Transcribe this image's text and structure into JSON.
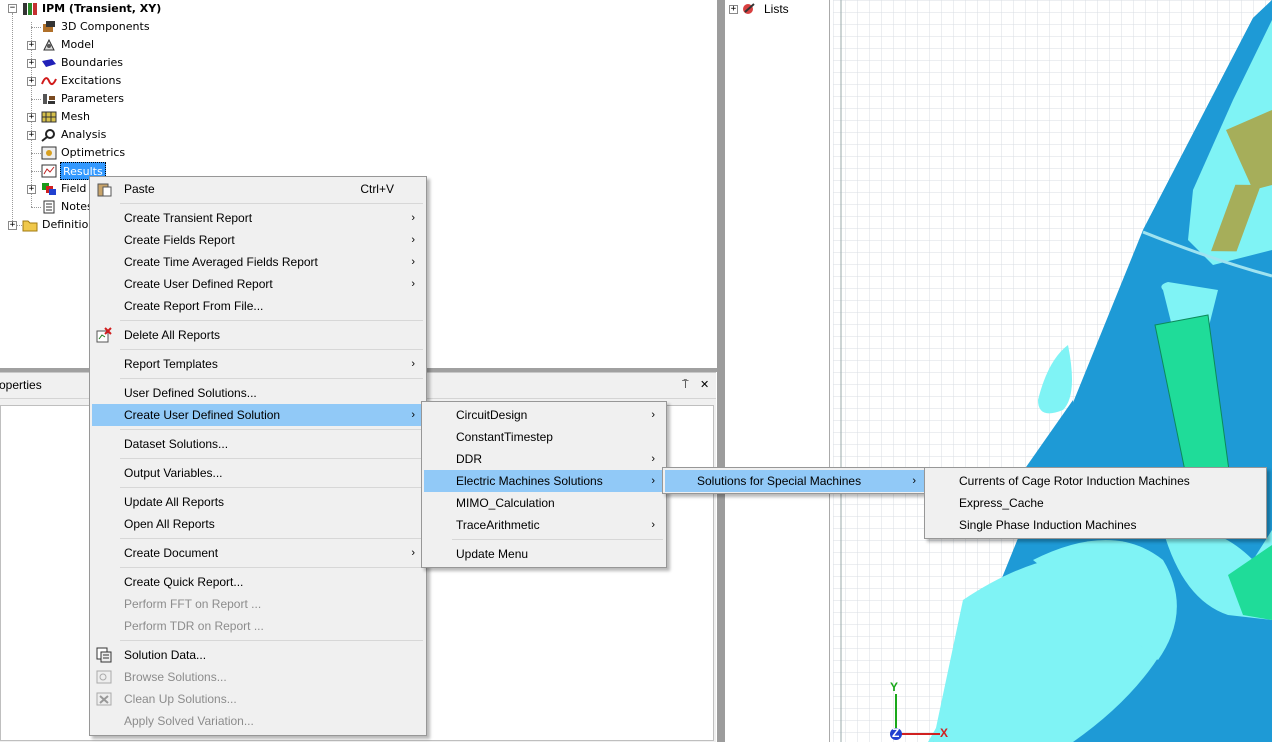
{
  "tree": {
    "root": "IPM (Transient, XY)",
    "items": [
      "3D Components",
      "Model",
      "Boundaries",
      "Excitations",
      "Parameters",
      "Mesh",
      "Analysis",
      "Optimetrics",
      "Results",
      "Field O",
      "Notes"
    ],
    "definitions": "Definitions"
  },
  "properties": {
    "title": "Properties",
    "pin_glyph": "⍑",
    "close_glyph": "✕"
  },
  "lists_label": "Lists",
  "context_menu": {
    "paste": "Paste",
    "paste_shortcut": "Ctrl+V",
    "create_transient_report": "Create Transient Report",
    "create_fields_report": "Create Fields Report",
    "create_time_averaged_fields_report": "Create Time Averaged Fields Report",
    "create_user_defined_report": "Create User Defined Report",
    "create_report_from_file": "Create Report From File...",
    "delete_all_reports": "Delete All Reports",
    "report_templates": "Report Templates",
    "user_defined_solutions": "User Defined Solutions...",
    "create_user_defined_solution": "Create User Defined Solution",
    "dataset_solutions": "Dataset Solutions...",
    "output_variables": "Output Variables...",
    "update_all_reports": "Update All Reports",
    "open_all_reports": "Open All Reports",
    "create_document": "Create Document",
    "create_quick_report": "Create Quick Report...",
    "perform_fft": "Perform FFT on Report ...",
    "perform_tdr": "Perform TDR on Report ...",
    "solution_data": "Solution Data...",
    "browse_solutions": "Browse Solutions...",
    "clean_up_solutions": "Clean Up Solutions...",
    "apply_solved_variation": "Apply Solved Variation..."
  },
  "submenu_uds": {
    "circuit_design": "CircuitDesign",
    "constant_timestep": "ConstantTimestep",
    "ddr": "DDR",
    "electric_machines_solutions": "Electric Machines Solutions",
    "mimo_calculation": "MIMO_Calculation",
    "trace_arithmetic": "TraceArithmetic",
    "update_menu": "Update Menu"
  },
  "submenu_em": {
    "solutions_for_special_machines": "Solutions for Special Machines"
  },
  "submenu_special": {
    "currents_cage_rotor": "Currents of Cage Rotor Induction Machines",
    "express_cache": "Express_Cache",
    "single_phase": "Single Phase Induction Machines"
  },
  "axes": {
    "y": "Y",
    "z": "Z",
    "x": "X"
  },
  "submenu_arrow": "›",
  "expander_plus": "+",
  "expander_minus": "−",
  "colors": {
    "highlight": "#91c9f7",
    "menu_bg": "#f0f0f0",
    "model_blue": "#1e9ad6",
    "model_cyan": "#7ff3f5",
    "model_green": "#1fdc99",
    "model_olive": "#a6ae5a",
    "grid_line": "#d8dde3"
  }
}
